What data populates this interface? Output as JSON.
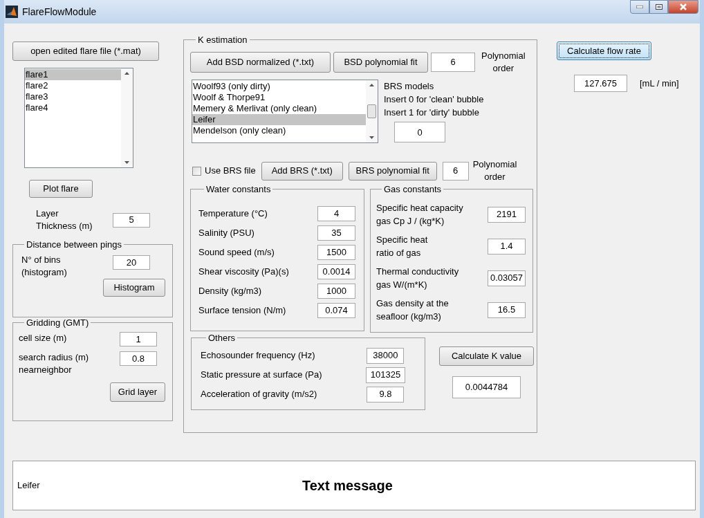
{
  "window": {
    "title": "FlareFlowModule"
  },
  "left": {
    "open_button": "open edited flare file (*.mat)",
    "flares": [
      {
        "label": "flare1",
        "selected": true
      },
      {
        "label": "flare2",
        "selected": false
      },
      {
        "label": "flare3",
        "selected": false
      },
      {
        "label": "flare4",
        "selected": false
      }
    ],
    "plot_button": "Plot flare",
    "layer_thickness": {
      "label": "Layer\nThickness (m)",
      "value": "5"
    },
    "distance_panel": {
      "title": "Distance between pings",
      "label": "N° of bins\n(histogram)",
      "value": "20",
      "button": "Histogram"
    },
    "gridding_panel": {
      "title": "Gridding (GMT)",
      "fields": [
        {
          "label": "cell size (m)",
          "value": "1"
        },
        {
          "label": "search radius (m)\nnearneighbor",
          "value": "0.8"
        }
      ],
      "button": "Grid layer"
    }
  },
  "k_estimation": {
    "title": "K estimation",
    "bsd_button": "Add BSD normalized (*.txt)",
    "bsd_fit_button": "BSD polynomial fit",
    "bsd_order": "6",
    "bsd_order_label": "Polynomial\norder",
    "brs_models": [
      {
        "label": "Woolf93 (only dirty)",
        "selected": false
      },
      {
        "label": "Woolf & Thorpe91",
        "selected": false
      },
      {
        "label": "Memery & Merlivat (only clean)",
        "selected": false
      },
      {
        "label": "Leifer",
        "selected": true
      },
      {
        "label": "Mendelson (only clean)",
        "selected": false
      }
    ],
    "brs_notes": [
      "BRS models",
      "Insert 0 for 'clean' bubble",
      "Insert 1 for 'dirty' bubble"
    ],
    "bubble_value": "0",
    "use_brs_file": {
      "label": "Use BRS file",
      "checked": false
    },
    "add_brs_button": "Add BRS (*.txt)",
    "brs_fit_button": "BRS polynomial fit",
    "brs_order": "6",
    "brs_order_label": "Polynomial\norder",
    "water": {
      "title": "Water constants",
      "fields": [
        {
          "label": "Temperature (°C)",
          "value": "4"
        },
        {
          "label": "Salinity (PSU)",
          "value": "35"
        },
        {
          "label": "Sound speed (m/s)",
          "value": "1500"
        },
        {
          "label": "Shear viscosity  (Pa)(s)",
          "value": "0.0014"
        },
        {
          "label": "Density (kg/m3)",
          "value": "1000"
        },
        {
          "label": "Surface tension (N/m)",
          "value": "0.074"
        }
      ]
    },
    "gas": {
      "title": "Gas constants",
      "fields": [
        {
          "label": "Specific heat capacity\ngas Cp  J / (kg*K)",
          "value": "2191"
        },
        {
          "label": "Specific heat\nratio of gas",
          "value": "1.4"
        },
        {
          "label": "Thermal conductivity\ngas W/(m*K)",
          "value": "0.03057"
        },
        {
          "label": "Gas density at the\nseafloor (kg/m3)",
          "value": "16.5"
        }
      ]
    },
    "others": {
      "title": "Others",
      "fields": [
        {
          "label": "Echosounder frequency (Hz)",
          "value": "38000"
        },
        {
          "label": "Static pressure at surface (Pa)",
          "value": "101325"
        },
        {
          "label": "Acceleration of gravity (m/s2)",
          "value": "9.8"
        }
      ]
    },
    "calc_k_button": "Calculate K value",
    "k_value": "0.0044784"
  },
  "flow": {
    "button": {
      "label": "Calculate flow rate",
      "focused": true
    },
    "value": "127.675",
    "unit": "[mL / min]"
  },
  "message": {
    "text": "Leifer",
    "title": "Text message"
  }
}
